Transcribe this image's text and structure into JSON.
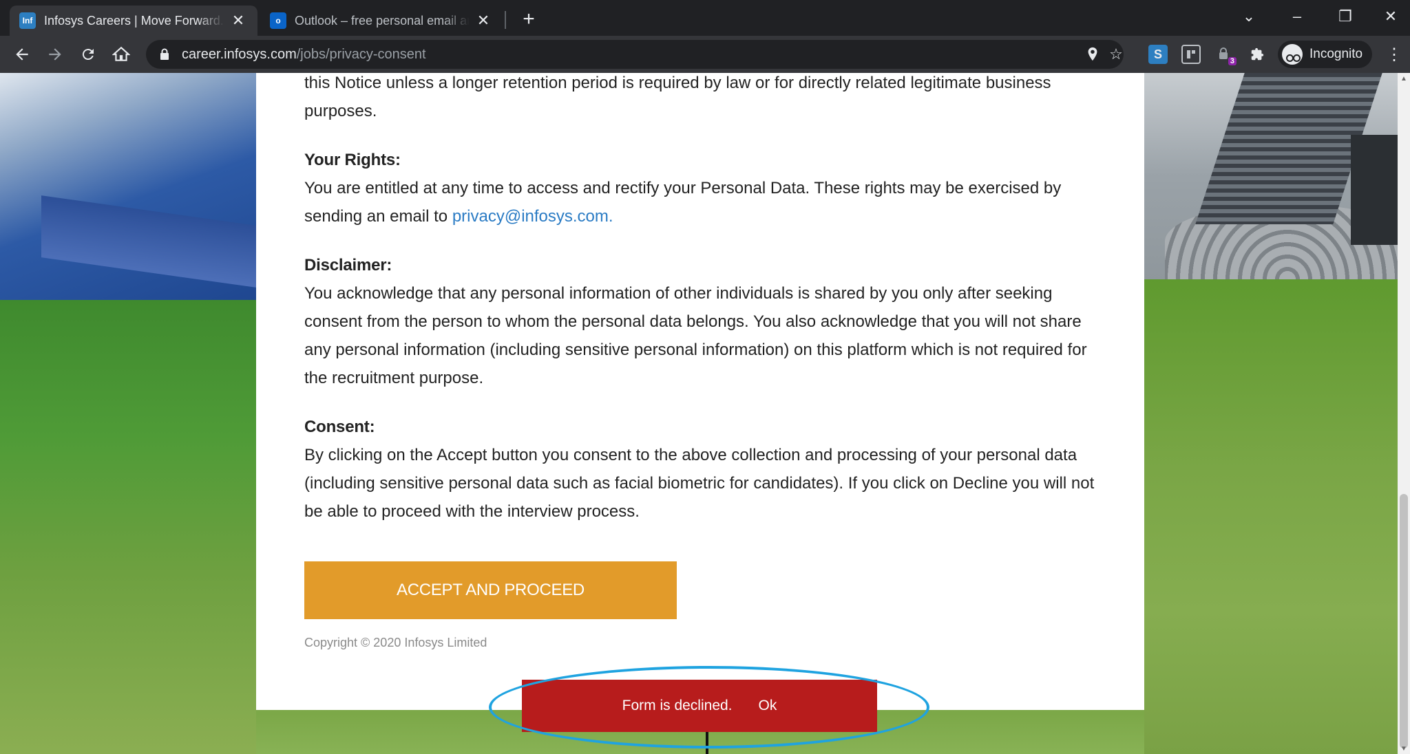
{
  "browser": {
    "tabs": [
      {
        "title": "Infosys Careers | Move Forward. S",
        "favicon": "Inf",
        "close": "✕"
      },
      {
        "title": "Outlook – free personal email an",
        "favicon": "o",
        "close": "✕"
      }
    ],
    "new_tab": "+",
    "window_controls": {
      "tabsearch": "⌄",
      "minimize": "–",
      "restore": "❐",
      "close": "✕"
    },
    "url_host": "career.infosys.com",
    "url_path": "/jobs/privacy-consent",
    "incognito_label": "Incognito",
    "extension_badge": "3"
  },
  "page": {
    "retention_text": "this Notice unless a longer retention period is required by law or for directly related legitimate business purposes.",
    "rights_heading": "Your Rights:",
    "rights_text": "You are entitled at any time to access and rectify your Personal Data. These rights may be exercised by sending an email to ",
    "rights_email": "privacy@infosys.com.",
    "disclaimer_heading": "Disclaimer:",
    "disclaimer_text": "You acknowledge that any personal information of other individuals is shared by you only after seeking consent from the person to whom the personal data belongs. You also acknowledge that you will not share any personal information (including sensitive personal information) on this platform which is not required for the recruitment purpose.",
    "consent_heading": "Consent:",
    "consent_text": "By clicking on the Accept button you consent to the above collection and processing of your personal data (including sensitive personal data such as facial biometric for candidates). If you click on Decline you will not be able to proceed with the interview process.",
    "accept_label": "ACCEPT AND PROCEED",
    "copyright": "Copyright © 2020 Infosys Limited"
  },
  "toast": {
    "message": "Form is declined.",
    "action": "Ok"
  },
  "colors": {
    "accept_button": "#e29b2a",
    "toast_bg": "#b71c1c",
    "highlight": "#1fa3e0",
    "link": "#2a7bc4"
  }
}
